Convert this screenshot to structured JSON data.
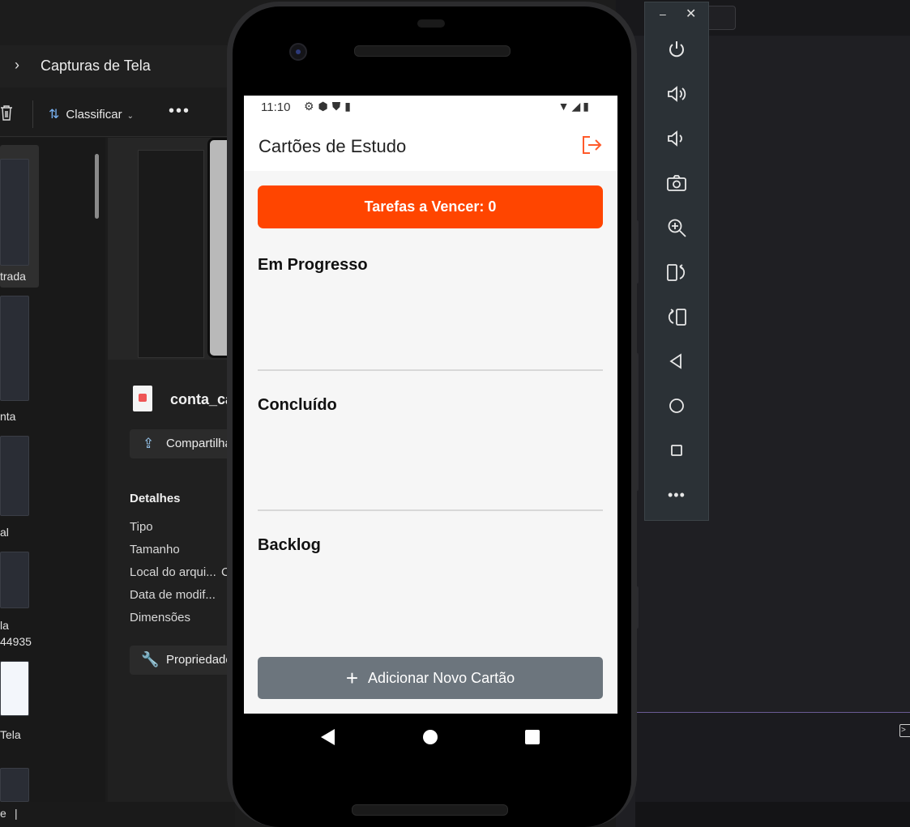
{
  "explorer": {
    "breadcrumb": "Capturas de Tela",
    "toolbar": {
      "sort_label": "Classificar"
    },
    "thumbnails": [
      {
        "label": "trada"
      },
      {
        "label": "nta"
      },
      {
        "label": "al"
      },
      {
        "label": "la\n44935"
      },
      {
        "label": "Tela"
      }
    ],
    "details": {
      "file_name": "conta_ca",
      "share_label": "Compartilhar",
      "heading": "Detalhes",
      "rows": [
        "Tipo",
        "Tamanho",
        "Local do arqui...",
        "Data de modif...",
        "Dimensões"
      ],
      "location_value": "C",
      "properties_label": "Propriedades"
    },
    "status_text": "e"
  },
  "phone": {
    "status": {
      "time": "11:10"
    },
    "app_title": "Cartões de Estudo",
    "due_button": "Tarefas a Vencer: 0",
    "sections": [
      "Em Progresso",
      "Concluído",
      "Backlog"
    ],
    "add_button": "Adicionar Novo Cartão",
    "accent_color": "#ff4500",
    "add_button_color": "#6c757d"
  },
  "emulator": {
    "buttons": [
      "power-icon",
      "volume-up-icon",
      "volume-down-icon",
      "camera-icon",
      "zoom-icon",
      "rotate-left-icon",
      "rotate-right-icon",
      "back-icon",
      "home-icon",
      "overview-icon",
      "more-icon"
    ]
  }
}
